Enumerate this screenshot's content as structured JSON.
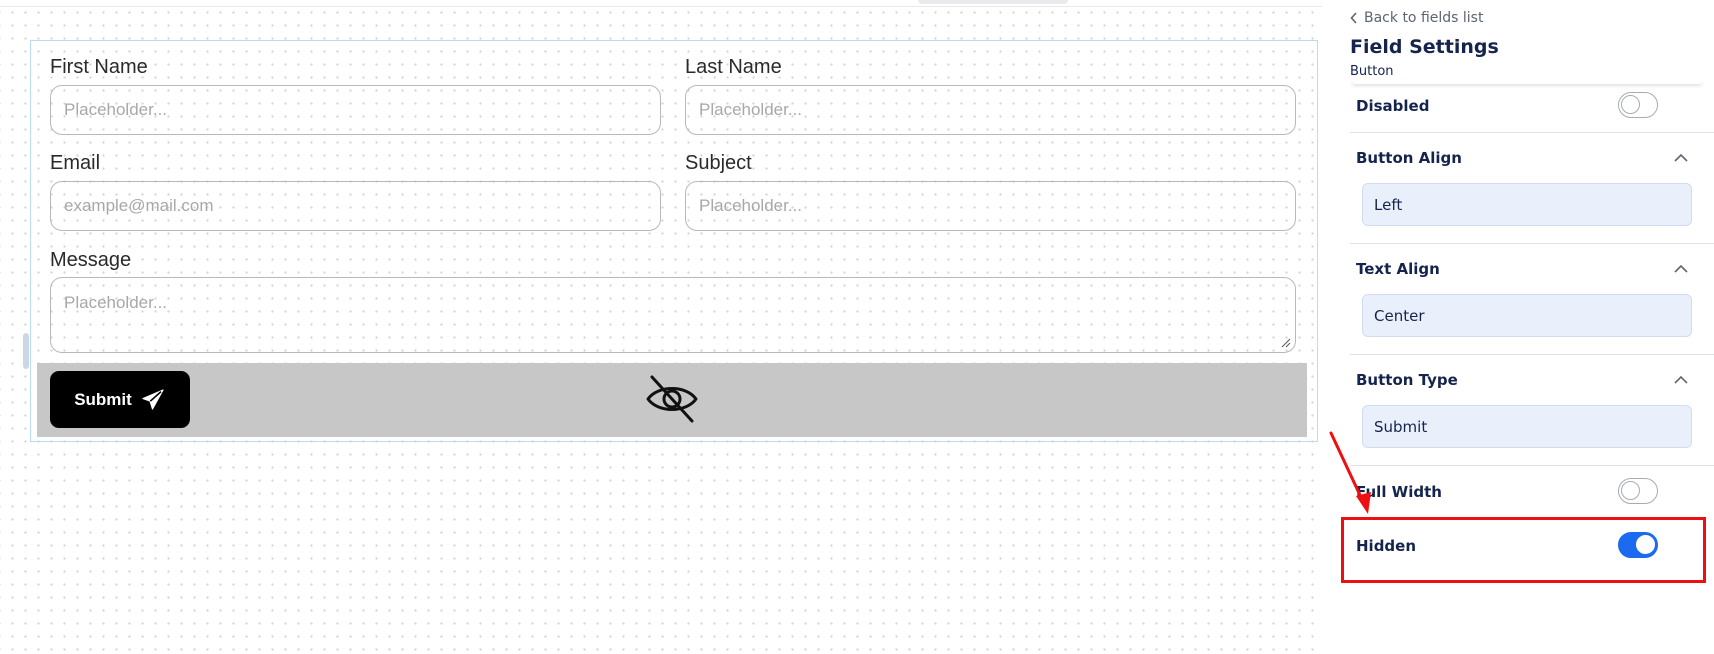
{
  "form": {
    "first_name": {
      "label": "First Name",
      "placeholder": "Placeholder..."
    },
    "last_name": {
      "label": "Last Name",
      "placeholder": "Placeholder..."
    },
    "email": {
      "label": "Email",
      "placeholder": "example@mail.com"
    },
    "subject": {
      "label": "Subject",
      "placeholder": "Placeholder..."
    },
    "message": {
      "label": "Message",
      "placeholder": "Placeholder..."
    },
    "submit_label": "Submit",
    "submit_icon": "send-icon",
    "hidden_indicator_icon": "eye-off-icon"
  },
  "panel": {
    "back_label": "Back to fields list",
    "title": "Field Settings",
    "subtitle": "Button",
    "disabled": {
      "label": "Disabled",
      "on": false
    },
    "button_align": {
      "label": "Button Align",
      "value": "Left"
    },
    "text_align": {
      "label": "Text Align",
      "value": "Center"
    },
    "button_type": {
      "label": "Button Type",
      "value": "Submit"
    },
    "full_width": {
      "label": "Full Width",
      "on": false
    },
    "hidden": {
      "label": "Hidden",
      "on": true
    }
  },
  "colors": {
    "accent": "#1b6af0",
    "highlight": "#ee1010",
    "panel_text": "#14244d"
  }
}
